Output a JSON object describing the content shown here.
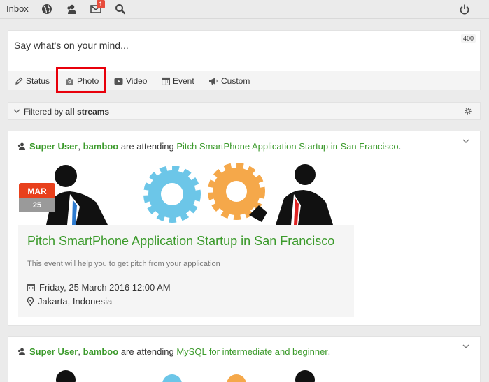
{
  "toolbar": {
    "inbox_label": "Inbox",
    "notification_count": "1",
    "icons": [
      "globe-icon",
      "friends-icon",
      "mail-icon",
      "search-icon",
      "power-icon"
    ]
  },
  "composer": {
    "placeholder": "Say what's on your mind...",
    "char_counter": "400",
    "tabs": [
      {
        "label": "Status",
        "icon": "pencil-icon"
      },
      {
        "label": "Photo",
        "icon": "camera-icon"
      },
      {
        "label": "Video",
        "icon": "video-icon"
      },
      {
        "label": "Event",
        "icon": "calendar-icon"
      },
      {
        "label": "Custom",
        "icon": "megaphone-icon"
      }
    ]
  },
  "filter": {
    "prefix": "Filtered by",
    "value": "all streams"
  },
  "stream": [
    {
      "actor_1": "Super User",
      "separator": ",",
      "actor_2": "bamboo",
      "verb": "are attending",
      "event_link": "Pitch SmartPhone Application Startup in San Francisco",
      "suffix": ".",
      "date_month": "MAR",
      "date_day": "25",
      "event_title": "Pitch SmartPhone Application Startup in San Francisco",
      "event_desc": "This event will help you to get pitch from your application",
      "event_datetime": "Friday, 25 March 2016 12:00 AM",
      "event_location": "Jakarta, Indonesia"
    },
    {
      "actor_1": "Super User",
      "separator": ",",
      "actor_2": "bamboo",
      "verb": "are attending",
      "event_link": "MySQL for intermediate and beginner",
      "suffix": "."
    }
  ],
  "colors": {
    "accent_green": "#3b9a2b",
    "highlight_red": "#e8000b",
    "badge_red": "#e74c3c",
    "gear_blue": "#6cc6e8",
    "gear_orange": "#f5a84a"
  }
}
